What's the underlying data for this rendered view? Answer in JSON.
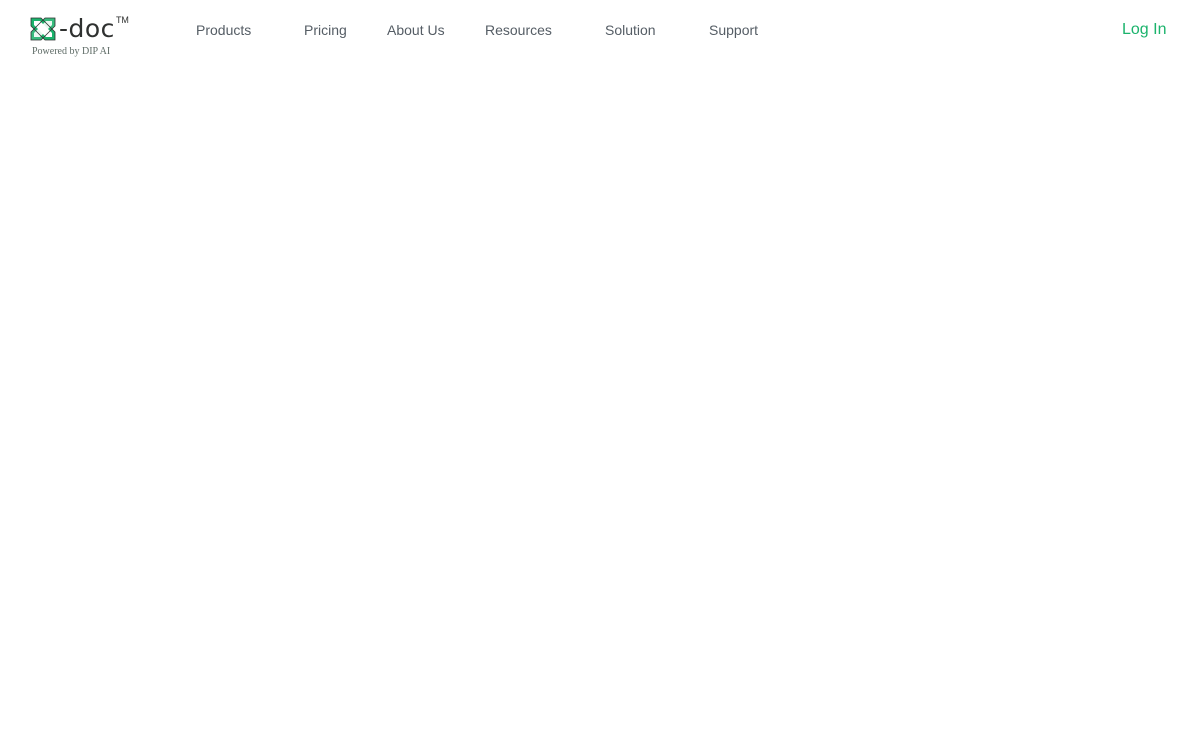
{
  "brand": {
    "logo_icon": "s-doc-logo-icon",
    "wordmark": "-doc",
    "trademark": "TM",
    "tagline": "Powered by DIP AI",
    "colors": {
      "logo_green": "#1bb36c",
      "logo_outline": "#2f3130"
    }
  },
  "nav": {
    "items": [
      {
        "label": "Products"
      },
      {
        "label": "Pricing"
      },
      {
        "label": "About Us"
      },
      {
        "label": "Resources"
      },
      {
        "label": "Solution"
      },
      {
        "label": "Support"
      }
    ]
  },
  "auth": {
    "login_label": "Log In",
    "color": "#1bb36c"
  },
  "theme": {
    "nav_text_color": "#555d65",
    "background": "#ffffff"
  }
}
